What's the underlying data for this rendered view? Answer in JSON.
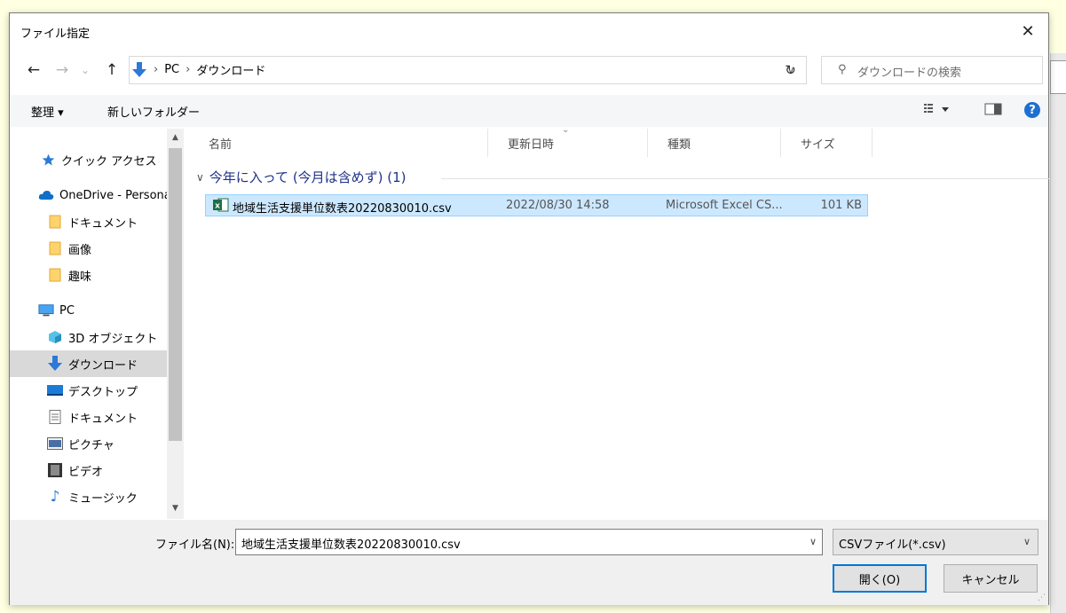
{
  "dialog": {
    "title": "ファイル指定"
  },
  "nav": {
    "back_icon": "←",
    "forward_icon": "→",
    "recent_icon": "⌄",
    "up_icon": "↑",
    "breadcrumb": [
      "PC",
      "ダウンロード"
    ],
    "refresh_icon": "↻",
    "search_placeholder": "ダウンロードの検索"
  },
  "toolbar": {
    "organize": "整理 ▾",
    "new_folder": "新しいフォルダー",
    "help": "?"
  },
  "sidebar": {
    "items": [
      {
        "label": "クイック アクセス",
        "icon": "star-icon"
      },
      {
        "label": "OneDrive - Personal",
        "icon": "cloud-icon"
      },
      {
        "label": "ドキュメント",
        "icon": "folder-icon"
      },
      {
        "label": "画像",
        "icon": "folder-icon"
      },
      {
        "label": "趣味",
        "icon": "folder-icon"
      },
      {
        "label": "PC",
        "icon": "monitor-icon"
      },
      {
        "label": "3D オブジェクト",
        "icon": "cube-icon"
      },
      {
        "label": "ダウンロード",
        "icon": "download-icon",
        "selected": true
      },
      {
        "label": "デスクトップ",
        "icon": "desktop-icon"
      },
      {
        "label": "ドキュメント",
        "icon": "document-icon"
      },
      {
        "label": "ピクチャ",
        "icon": "picture-icon"
      },
      {
        "label": "ビデオ",
        "icon": "video-icon"
      },
      {
        "label": "ミュージック",
        "icon": "music-icon"
      }
    ]
  },
  "columns": [
    "名前",
    "更新日時",
    "種類",
    "サイズ"
  ],
  "group": {
    "label": "今年に入って (今月は含めず) (1)"
  },
  "files": [
    {
      "name": "地域生活支援単位数表20220830010.csv",
      "date": "2022/08/30 14:58",
      "type": "Microsoft Excel CS...",
      "size": "101 KB"
    }
  ],
  "bottom": {
    "filename_label": "ファイル名(N):",
    "filename_value": "地域生活支援単位数表20220830010.csv",
    "filter_value": "CSVファイル(*.csv)",
    "open_label": "開く(O)",
    "cancel_label": "キャンセル"
  },
  "colors": {
    "accent": "#0078d7",
    "selection": "#cce8ff",
    "group_header": "#1e3287"
  }
}
